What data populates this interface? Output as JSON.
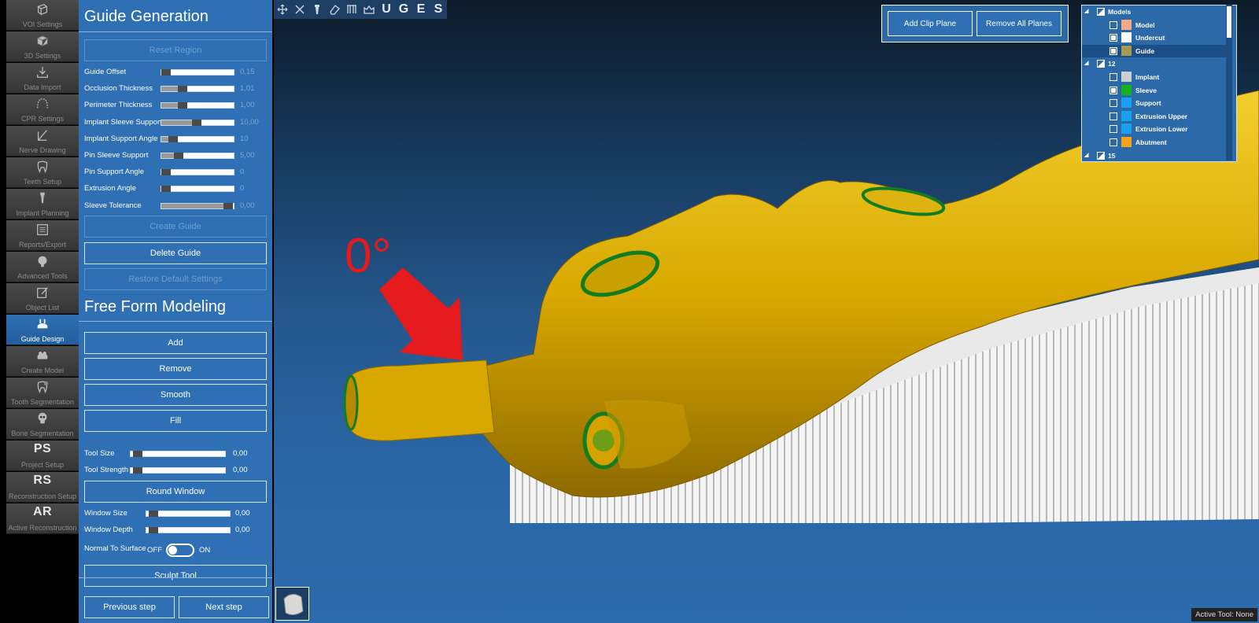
{
  "nav": {
    "items": [
      {
        "label": "VOI Settings",
        "icon": "voi-cube-icon",
        "active": false
      },
      {
        "label": "3D Settings",
        "icon": "3d-cube-icon",
        "active": false
      },
      {
        "label": "Data Import",
        "icon": "download-icon",
        "active": false
      },
      {
        "label": "CPR Settings",
        "icon": "arch-icon",
        "active": false
      },
      {
        "label": "Nerve Drawing",
        "icon": "nerve-pen-icon",
        "active": false
      },
      {
        "label": "Teeth Setup",
        "icon": "tooth-icon",
        "active": false
      },
      {
        "label": "Implant Planning",
        "icon": "implant-icon",
        "active": false
      },
      {
        "label": "Reports/Export",
        "icon": "report-icon",
        "active": false
      },
      {
        "label": "Advanced Tools",
        "icon": "head-gear-icon",
        "active": false
      },
      {
        "label": "Object List",
        "icon": "edit-list-icon",
        "active": false
      },
      {
        "label": "Guide Design",
        "icon": "guide-icon",
        "active": true
      },
      {
        "label": "Create Model",
        "icon": "model-icon",
        "active": false
      },
      {
        "label": "Tooth Segmentation",
        "icon": "tooth-seg-icon",
        "active": false
      },
      {
        "label": "Bone Segmentation",
        "icon": "skull-icon",
        "active": false
      },
      {
        "label": "Project Setup",
        "icon_text": "PS",
        "active": false
      },
      {
        "label": "Reconstruction Setup",
        "icon_text": "RS",
        "active": false
      },
      {
        "label": "Active Reconstruction",
        "icon_text": "AR",
        "active": false
      }
    ]
  },
  "panel": {
    "guide_title": "Guide Generation",
    "reset_region": "Reset Region",
    "params": [
      {
        "label": "Guide Offset",
        "value": "0,15",
        "level": 0.02
      },
      {
        "label": "Occlusion Thickness",
        "value": "1,01",
        "level": 0.25
      },
      {
        "label": "Perimeter Thickness",
        "value": "1,00",
        "level": 0.25
      },
      {
        "label": "Implant Sleeve Support",
        "value": "10,00",
        "level": 0.45
      },
      {
        "label": "Implant Support Angle",
        "value": "10",
        "level": 0.12
      },
      {
        "label": "Pin Sleeve Support",
        "value": "5,00",
        "level": 0.2
      },
      {
        "label": "Pin Support Angle",
        "value": "0",
        "level": 0.0
      },
      {
        "label": "Extrusion Angle",
        "value": "0",
        "level": 0.0
      },
      {
        "label": "Sleeve Tolerance",
        "value": "0,00",
        "level": 0.9
      }
    ],
    "create_guide": "Create Guide",
    "delete_guide": "Delete Guide",
    "restore_defaults": "Restore Default Settings",
    "ffm_title": "Free Form Modeling",
    "add": "Add",
    "remove": "Remove",
    "smooth": "Smooth",
    "fill": "Fill",
    "tool_size_label": "Tool Size",
    "tool_size_value": "0,00",
    "tool_strength_label": "Tool Strength",
    "tool_strength_value": "0,00",
    "round_window": "Round Window",
    "window_size_label": "Window Size",
    "window_size_value": "0,00",
    "window_depth_label": "Window Depth",
    "window_depth_value": "0,00",
    "normal_label": "Normal To Surface",
    "off": "OFF",
    "on": "ON",
    "normal_on": false,
    "sculpt_tool": "Sculpt Tool",
    "prev": "Previous step",
    "next": "Next step"
  },
  "toolbar": {
    "icons": [
      "move-icon",
      "close-icon",
      "implant-tool-icon",
      "eraser-icon",
      "pin-tool-icon",
      "crown-tool-icon"
    ],
    "letters": [
      "U",
      "G",
      "E",
      "S"
    ]
  },
  "clip": {
    "add": "Add Clip Plane",
    "remove_all": "Remove All Planes"
  },
  "tree": {
    "rows": [
      {
        "type": "group",
        "name": "Models",
        "check": "half"
      },
      {
        "type": "leaf",
        "name": "Model",
        "color": "#f2a98a",
        "check": "off"
      },
      {
        "type": "leaf",
        "name": "Undercut",
        "color": "#ffffff",
        "check": "on"
      },
      {
        "type": "leaf",
        "name": "Guide",
        "color": "#a69a52",
        "check": "on",
        "selected": true
      },
      {
        "type": "group",
        "name": "12",
        "check": "half"
      },
      {
        "type": "leaf",
        "name": "Implant",
        "color": "#cfcfcf",
        "check": "off"
      },
      {
        "type": "leaf",
        "name": "Sleeve",
        "color": "#16b21c",
        "check": "on"
      },
      {
        "type": "leaf",
        "name": "Support",
        "color": "#1aa0f0",
        "check": "off"
      },
      {
        "type": "leaf",
        "name": "Extrusion Upper",
        "color": "#1aa0f0",
        "check": "off"
      },
      {
        "type": "leaf",
        "name": "Extrusion Lower",
        "color": "#1aa0f0",
        "check": "off"
      },
      {
        "type": "leaf",
        "name": "Abutment",
        "color": "#f5a21a",
        "check": "off"
      },
      {
        "type": "group",
        "name": "15",
        "check": "half"
      }
    ]
  },
  "annotation": "0°",
  "status": "Active Tool: None",
  "colors": {
    "panel": "#2f6fb3",
    "guide_yellow": "#d9a800",
    "sleeve_green": "#1a9a2a",
    "arrow_red": "#e41a1c"
  }
}
